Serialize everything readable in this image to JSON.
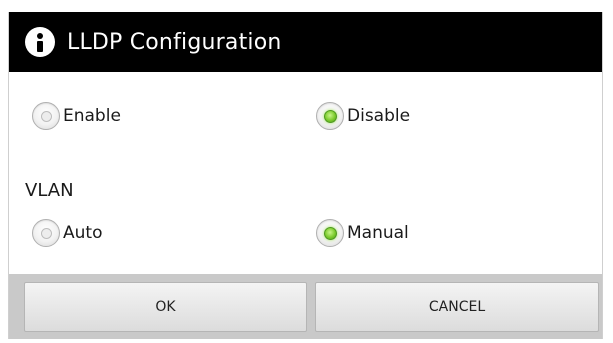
{
  "dialog": {
    "title": "LLDP Configuration",
    "icon": "info-icon"
  },
  "lldp": {
    "options": [
      {
        "label": "Enable",
        "checked": false
      },
      {
        "label": "Disable",
        "checked": true
      }
    ]
  },
  "vlan": {
    "label": "VLAN",
    "options": [
      {
        "label": "Auto",
        "checked": false
      },
      {
        "label": "Manual",
        "checked": true
      }
    ]
  },
  "buttons": {
    "ok_label": "OK",
    "cancel_label": "CANCEL"
  },
  "colors": {
    "titlebar": "#000000",
    "radio_checked": "#7ccb2d",
    "button_bar": "#c9c9c9"
  }
}
